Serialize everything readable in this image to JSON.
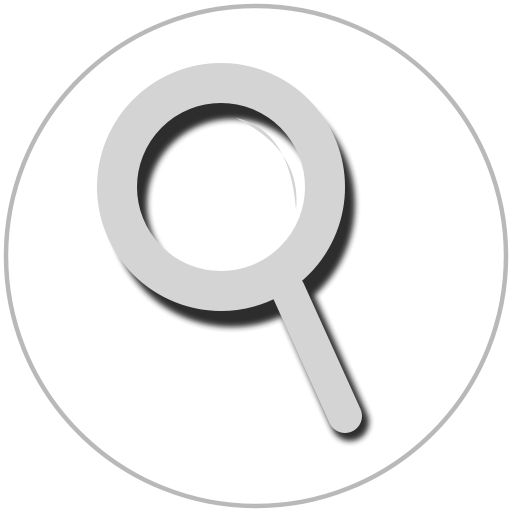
{
  "icon": {
    "name": "search-icon",
    "badge_shape": "circle",
    "colors": {
      "background": "#ffffff",
      "ring": "#b9b9b9",
      "lens": "#d4d4d4",
      "shadow": "#1e1e1e"
    }
  }
}
